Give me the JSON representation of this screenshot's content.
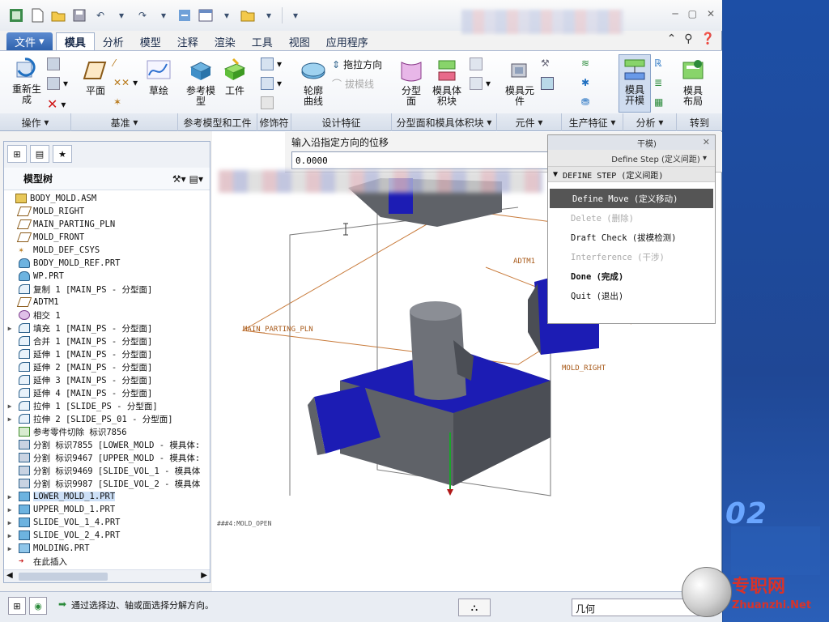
{
  "qat": {
    "icons": [
      "app-icon",
      "new-icon",
      "open-icon",
      "save-icon",
      "undo-icon",
      "redo-icon",
      "regenerate-icon",
      "windows-icon",
      "folder-icon",
      "customize-icon"
    ]
  },
  "tabs": [
    "文件",
    "模具",
    "分析",
    "模型",
    "注释",
    "渲染",
    "工具",
    "视图",
    "应用程序"
  ],
  "active_tab": "模具",
  "ribbon": {
    "regenerate": "重新生\n成",
    "plane": "平面",
    "sketch": "草绘",
    "ref_model": "参考模\n型",
    "workpiece": "工件",
    "profile_curve": "轮廓\n曲线",
    "drag_direction": "拖拉方向",
    "draft_line": "拔模线",
    "parting_surface": "分型\n面",
    "mold_volume": "模具体\n积块",
    "mold_component": "模具元\n件",
    "mold_open": "模具\n开模",
    "mold_layout": "模具\n布局"
  },
  "groups": [
    "操作",
    "基准",
    "参考模型和工件",
    "修饰符",
    "设计特征",
    "分型面和模具体积块",
    "元件",
    "生产特征",
    "分析",
    "转到"
  ],
  "tree": {
    "title": "模型树",
    "items": [
      {
        "text": "BODY_MOLD.ASM",
        "icon": "assembly",
        "expand": false,
        "indent": 0
      },
      {
        "text": "MOLD_RIGHT",
        "icon": "plane",
        "expand": false,
        "indent": 1
      },
      {
        "text": "MAIN_PARTING_PLN",
        "icon": "plane",
        "expand": false,
        "indent": 1
      },
      {
        "text": "MOLD_FRONT",
        "icon": "plane",
        "expand": false,
        "indent": 1
      },
      {
        "text": "MOLD_DEF_CSYS",
        "icon": "csys",
        "expand": false,
        "indent": 1
      },
      {
        "text": "BODY_MOLD_REF.PRT",
        "icon": "part",
        "expand": false,
        "indent": 1
      },
      {
        "text": "WP.PRT",
        "icon": "part",
        "expand": false,
        "indent": 1
      },
      {
        "text": "复制 1 [MAIN_PS - 分型面]",
        "icon": "surface",
        "expand": false,
        "indent": 1
      },
      {
        "text": "ADTM1",
        "icon": "plane",
        "expand": false,
        "indent": 1
      },
      {
        "text": "相交 1",
        "icon": "intersect",
        "expand": false,
        "indent": 1
      },
      {
        "text": "填充 1 [MAIN_PS - 分型面]",
        "icon": "surface",
        "expand": true,
        "indent": 1
      },
      {
        "text": "合并 1 [MAIN_PS - 分型面]",
        "icon": "surface",
        "expand": false,
        "indent": 1
      },
      {
        "text": "延伸 1 [MAIN_PS - 分型面]",
        "icon": "surface",
        "expand": false,
        "indent": 1
      },
      {
        "text": "延伸 2 [MAIN_PS - 分型面]",
        "icon": "surface",
        "expand": false,
        "indent": 1
      },
      {
        "text": "延伸 3 [MAIN_PS - 分型面]",
        "icon": "surface",
        "expand": false,
        "indent": 1
      },
      {
        "text": "延伸 4 [MAIN_PS - 分型面]",
        "icon": "surface",
        "expand": false,
        "indent": 1
      },
      {
        "text": "拉伸 1 [SLIDE_PS - 分型面]",
        "icon": "surface",
        "expand": true,
        "indent": 1
      },
      {
        "text": "拉伸 2 [SLIDE_PS_01 - 分型面]",
        "icon": "surface",
        "expand": true,
        "indent": 1
      },
      {
        "text": "参考零件切除 标识7856",
        "icon": "cut",
        "expand": false,
        "indent": 1
      },
      {
        "text": "分割 标识7855 [LOWER_MOLD - 模具体:",
        "icon": "split",
        "expand": false,
        "indent": 1
      },
      {
        "text": "分割 标识9467 [UPPER_MOLD - 模具体:",
        "icon": "split",
        "expand": false,
        "indent": 1
      },
      {
        "text": "分割 标识9469 [SLIDE_VOL_1 - 模具体",
        "icon": "split",
        "expand": false,
        "indent": 1
      },
      {
        "text": "分割 标识9987 [SLIDE_VOL_2 - 模具体",
        "icon": "split",
        "expand": false,
        "indent": 1
      },
      {
        "text": "LOWER_MOLD_1.PRT",
        "icon": "mold",
        "expand": true,
        "indent": 1,
        "selected": true
      },
      {
        "text": "UPPER_MOLD_1.PRT",
        "icon": "mold",
        "expand": true,
        "indent": 1
      },
      {
        "text": "SLIDE_VOL_1_4.PRT",
        "icon": "mold",
        "expand": true,
        "indent": 1
      },
      {
        "text": "SLIDE_VOL_2_4.PRT",
        "icon": "mold",
        "expand": true,
        "indent": 1
      },
      {
        "text": "MOLDING.PRT",
        "icon": "molding",
        "expand": true,
        "indent": 1
      },
      {
        "text": "在此插入",
        "icon": "insert-arrow",
        "expand": false,
        "indent": 1
      }
    ]
  },
  "prompt": {
    "label": "输入沿指定方向的位移",
    "value": "0.0000"
  },
  "menu": {
    "header": "干模)",
    "sub": "Define Step (定义间距)",
    "step": "DEFINE STEP (定义间距)",
    "items": [
      {
        "text": "Define Move (定义移动)",
        "state": "highlight"
      },
      {
        "text": "Delete (删除)",
        "state": "dim"
      },
      {
        "text": "Draft Check (拔模检测)",
        "state": "normal"
      },
      {
        "text": "Interference (干涉)",
        "state": "dim"
      },
      {
        "text": "Done (完成)",
        "state": "bold"
      },
      {
        "text": "Quit (退出)",
        "state": "normal"
      }
    ]
  },
  "viewport": {
    "labels": {
      "adtm": "ADTM1",
      "parting": "MAIN_PARTING_PLN",
      "right": "MOLD_RIGHT",
      "view": "###4:MOLD_OPEN"
    },
    "colors": {
      "mold": "#1c1cb4",
      "gray": "#5f6268",
      "plane": "#c87a3a"
    }
  },
  "status": {
    "message": "通过选择边、轴或面选择分解方向。",
    "filter": "几何"
  },
  "brand": {
    "number": "02",
    "site_cn": "专职网",
    "site_en": "Zhuanzhi.Net"
  }
}
